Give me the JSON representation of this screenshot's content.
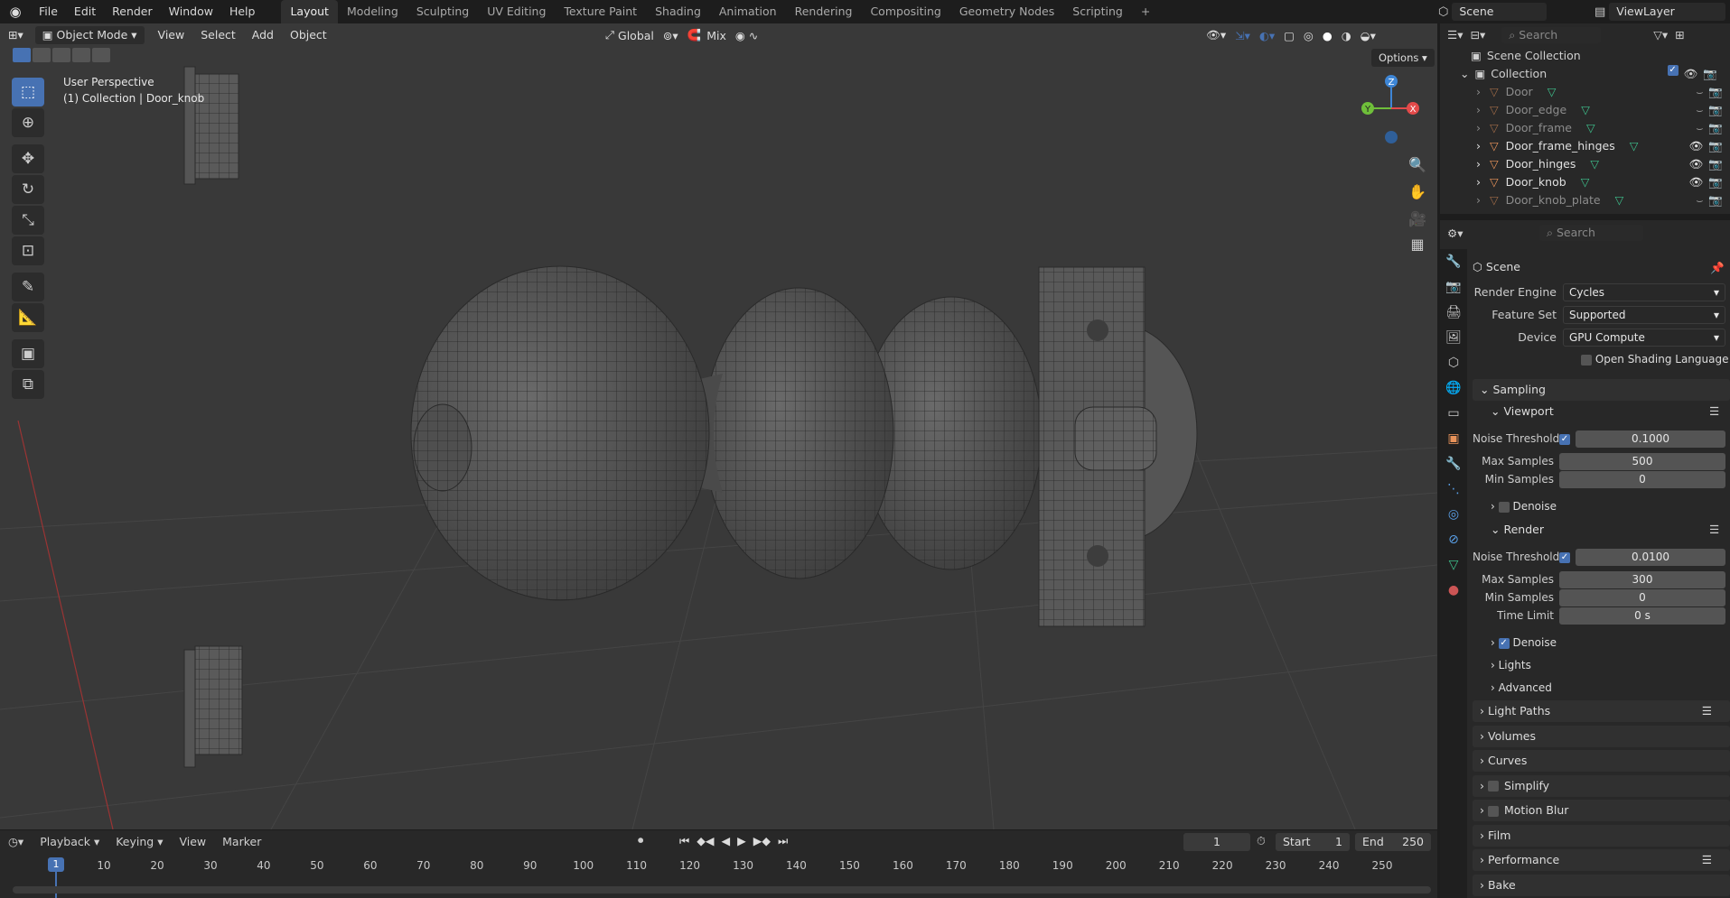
{
  "topbar": {
    "menus": [
      "File",
      "Edit",
      "Render",
      "Window",
      "Help"
    ],
    "workspaces": [
      "Layout",
      "Modeling",
      "Sculpting",
      "UV Editing",
      "Texture Paint",
      "Shading",
      "Animation",
      "Rendering",
      "Compositing",
      "Geometry Nodes",
      "Scripting"
    ],
    "active_workspace": "Layout",
    "add_tab": "+",
    "scene": "Scene",
    "view_layer": "ViewLayer"
  },
  "viewport": {
    "mode": "Object Mode",
    "menus": [
      "View",
      "Select",
      "Add",
      "Object"
    ],
    "orientation": "Global",
    "snap": "Mix",
    "options": "Options",
    "perspective_label": "User Perspective",
    "context_label": "(1) Collection | Door_knob",
    "gizmo": {
      "x": "X",
      "y": "Y",
      "z": "Z"
    }
  },
  "outliner": {
    "search_placeholder": "Search",
    "scene_collection": "Scene Collection",
    "collection": "Collection",
    "items": [
      {
        "name": "Door",
        "dim": true
      },
      {
        "name": "Door_edge",
        "dim": true
      },
      {
        "name": "Door_frame",
        "dim": true
      },
      {
        "name": "Door_frame_hinges",
        "dim": false
      },
      {
        "name": "Door_hinges",
        "dim": false
      },
      {
        "name": "Door_knob",
        "dim": false
      },
      {
        "name": "Door_knob_plate",
        "dim": true
      }
    ]
  },
  "properties": {
    "search_placeholder": "Search",
    "context": "Scene",
    "render_engine_label": "Render Engine",
    "render_engine": "Cycles",
    "feature_set_label": "Feature Set",
    "feature_set": "Supported",
    "device_label": "Device",
    "device": "GPU Compute",
    "osl_label": "Open Shading Language",
    "sampling": "Sampling",
    "viewport_sub": "Viewport",
    "noise_threshold_label": "Noise Threshold",
    "vp_noise_threshold": "0.1000",
    "max_samples_label": "Max Samples",
    "vp_max_samples": "500",
    "min_samples_label": "Min Samples",
    "vp_min_samples": "0",
    "denoise_label": "Denoise",
    "render_sub": "Render",
    "r_noise_threshold": "0.0100",
    "r_max_samples": "300",
    "r_min_samples": "0",
    "time_limit_label": "Time Limit",
    "r_time_limit": "0 s",
    "lights": "Lights",
    "advanced": "Advanced",
    "sections": [
      "Light Paths",
      "Volumes",
      "Curves",
      "Simplify",
      "Motion Blur",
      "Film",
      "Performance",
      "Bake"
    ]
  },
  "timeline": {
    "menus": [
      "Playback",
      "Keying",
      "View",
      "Marker"
    ],
    "current_frame": "1",
    "start_label": "Start",
    "start": "1",
    "end_label": "End",
    "end": "250",
    "ticks": [
      "1",
      "10",
      "20",
      "30",
      "40",
      "50",
      "60",
      "70",
      "80",
      "90",
      "100",
      "110",
      "120",
      "130",
      "140",
      "150",
      "160",
      "170",
      "180",
      "190",
      "200",
      "210",
      "220",
      "230",
      "240",
      "250"
    ]
  },
  "colors": {
    "accent": "#4772b3",
    "x_axis": "#e34a4a",
    "y_axis": "#6fbf3a",
    "z_axis": "#3e86d6",
    "mesh_icon": "#3ec08c",
    "object_icon": "#e8935a"
  }
}
